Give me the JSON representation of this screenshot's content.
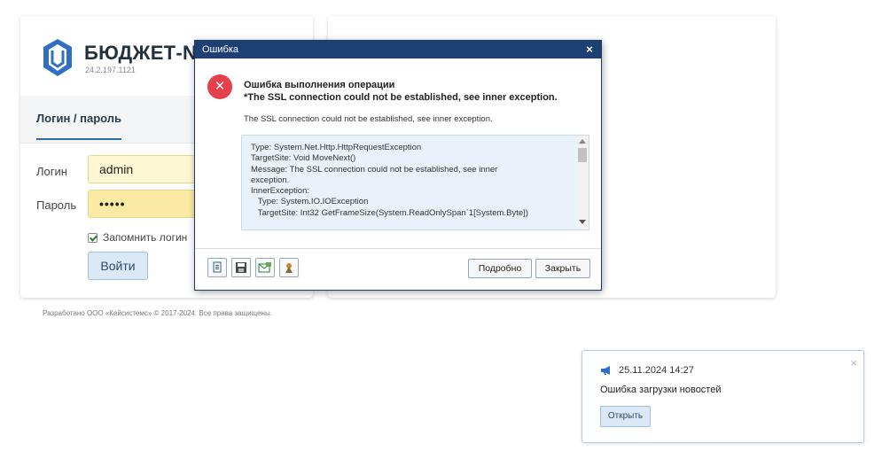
{
  "login": {
    "brand_name": "БЮДЖЕТ-NET",
    "version": "24.2.197.1121",
    "tab_label": "Логин / пароль",
    "login_label": "Логин",
    "login_value": "admin",
    "password_label": "Пароль",
    "password_value": "•••••",
    "remember_label": "Запомнить логин",
    "remember_checked": true,
    "submit_label": "Войти"
  },
  "footer": {
    "text": "Разработано ООО «Кейсистемс» © 2017-2024. Все права защищены."
  },
  "dialog": {
    "title": "Ошибка",
    "close_glyph": "×",
    "error_icon_glyph": "×",
    "heading": "Ошибка выполнения операции",
    "subheading": "*The SSL connection could not be established, see inner exception.",
    "message": "The SSL connection could not be established, see inner exception.",
    "details": [
      "Type: System.Net.Http.HttpRequestException",
      "TargetSite: Void MoveNext()",
      "Message: The SSL connection could not be established, see inner",
      "exception.",
      "InnerException:",
      "   Type: System.IO.IOException",
      "   TargetSite: Int32 GetFrameSize(System.ReadOnlySpan`1[System.Byte])"
    ],
    "details_button": "Подробно",
    "close_button": "Закрыть",
    "toolbar_icons": [
      "copy-icon",
      "save-icon",
      "email-icon",
      "settings-icon"
    ]
  },
  "notification": {
    "datetime": "25.11.2024 14:27",
    "text": "Ошибка загрузки новостей",
    "open_button": "Открыть",
    "close_glyph": "×"
  },
  "colors": {
    "dialog_title_bg": "#1c3f74",
    "error_red": "#e5404b",
    "logo_blue": "#2f6fc4",
    "input_highlight": "#fdf7d3"
  }
}
